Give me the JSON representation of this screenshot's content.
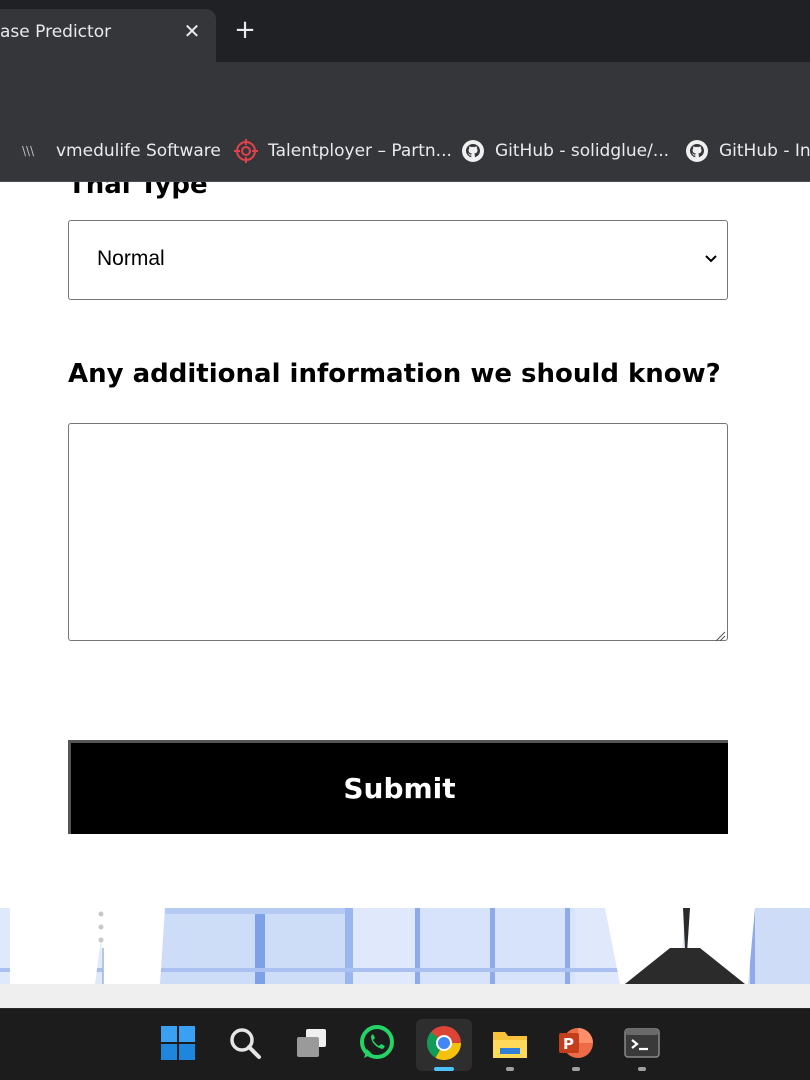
{
  "browser": {
    "active_tab_title": "ase Predictor",
    "close_glyph": "✕",
    "new_tab_glyph": "+",
    "bookmarks": [
      {
        "label": "vmedulife Software",
        "icon": "vmedulife-icon"
      },
      {
        "label": "Talentployer – Partn...",
        "icon": "target-icon"
      },
      {
        "label": "GitHub - solidglue/...",
        "icon": "github-icon"
      },
      {
        "label": "GitHub - Inn",
        "icon": "github-icon"
      }
    ]
  },
  "form": {
    "thal_label": "Thal Type",
    "thal_selected": "Normal",
    "additional_info_label": "Any additional information we should know?",
    "additional_info_value": "",
    "submit_label": "Submit"
  },
  "taskbar": {
    "items": [
      {
        "name": "windows-start-icon",
        "active": false
      },
      {
        "name": "search-icon",
        "active": false
      },
      {
        "name": "task-view-icon",
        "active": false
      },
      {
        "name": "whatsapp-icon",
        "active": false
      },
      {
        "name": "chrome-icon",
        "active": true
      },
      {
        "name": "file-explorer-icon",
        "active": false
      },
      {
        "name": "powerpoint-icon",
        "active": false
      },
      {
        "name": "terminal-icon",
        "active": false
      }
    ]
  },
  "colors": {
    "chrome_dark": "#202124",
    "chrome_toolbar": "#35363a",
    "submit_bg": "#000000",
    "taskbar_bg": "#1c1c1c",
    "active_indicator": "#4cc2ff"
  }
}
